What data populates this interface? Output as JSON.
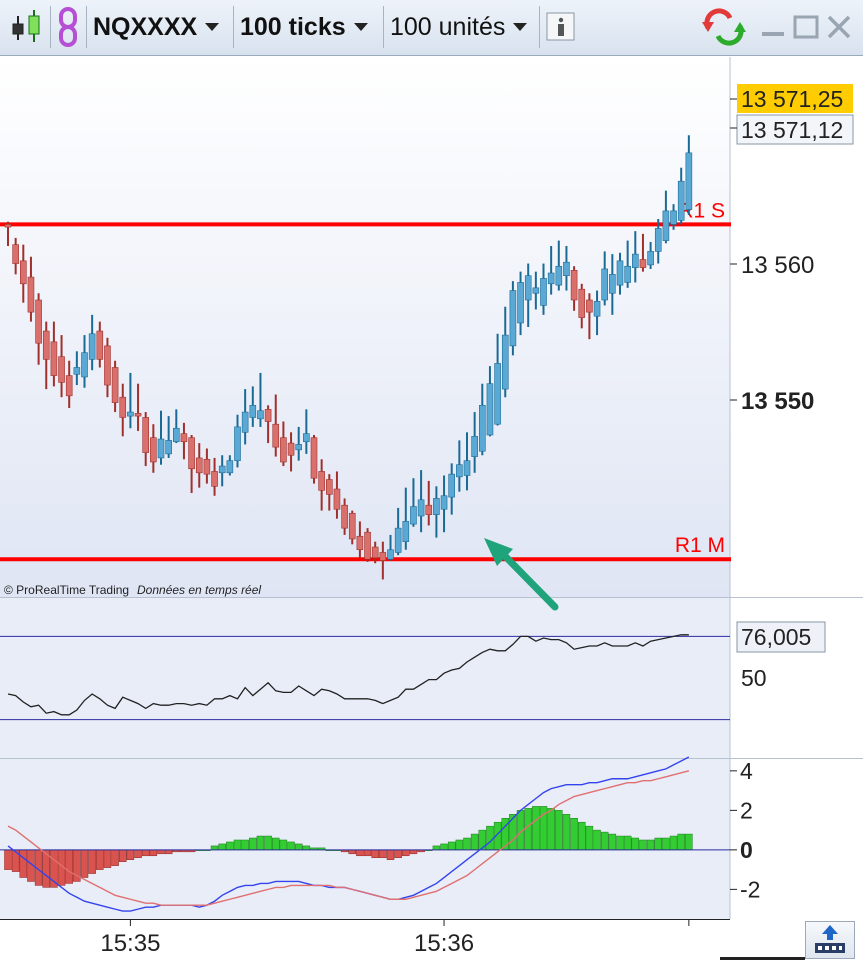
{
  "toolbar": {
    "symbol": "NQXXXX",
    "timeframe": "100 ticks",
    "units": "100 unités",
    "icons": [
      "candlestick-icon",
      "link-icon",
      "info-icon",
      "refresh-arrows-icon",
      "minimize-icon",
      "maximize-icon",
      "close-icon"
    ]
  },
  "copyright": "© ProRealTime Trading",
  "realtime_note": "Données en temps réel",
  "chart_data": [
    {
      "type": "candlestick",
      "price_labels": {
        "last": "13 571,25",
        "bid": "13 571,12",
        "tick_560": "13 560",
        "tick_550": "13 550"
      },
      "yticks": [
        13560,
        13550
      ],
      "ylim": [
        13538.4,
        13578.4
      ],
      "levels": [
        {
          "name": "R1 S",
          "value": 13566.0,
          "color": "#ff0000"
        },
        {
          "name": "R1 M",
          "value": 13541.2,
          "color": "#ff0000"
        }
      ],
      "up_color": "#5aa9d4",
      "down_color": "#d9706c",
      "candles": [
        [
          13566.0,
          13565.8,
          13564.4,
          13566.2
        ],
        [
          13564.5,
          13563.1,
          13562.3,
          13565.0
        ],
        [
          13563.3,
          13561.6,
          13560.2,
          13564.5
        ],
        [
          13562.1,
          13559.5,
          13558.8,
          13563.6
        ],
        [
          13560.4,
          13557.2,
          13555.6,
          13560.9
        ],
        [
          13558.1,
          13556.0,
          13553.8,
          13558.8
        ],
        [
          13557.3,
          13554.8,
          13554.0,
          13558.8
        ],
        [
          13556.2,
          13554.3,
          13553.2,
          13557.8
        ],
        [
          13554.8,
          13553.3,
          13552.4,
          13555.9
        ],
        [
          13554.9,
          13555.4,
          13554.1,
          13556.6
        ],
        [
          13554.7,
          13556.5,
          13553.9,
          13557.8
        ],
        [
          13556.0,
          13557.9,
          13555.2,
          13559.3
        ],
        [
          13558.1,
          13556.0,
          13555.4,
          13558.8
        ],
        [
          13557.0,
          13554.1,
          13553.2,
          13557.6
        ],
        [
          13555.4,
          13552.8,
          13552.1,
          13555.9
        ],
        [
          13553.2,
          13551.7,
          13550.3,
          13554.2
        ],
        [
          13551.8,
          13552.1,
          13550.9,
          13555.0
        ],
        [
          13552.0,
          13551.8,
          13550.7,
          13554.2
        ],
        [
          13551.7,
          13549.1,
          13548.1,
          13552.1
        ],
        [
          13550.2,
          13548.4,
          13547.6,
          13551.2
        ],
        [
          13548.7,
          13550.1,
          13548.2,
          13552.2
        ],
        [
          13549.0,
          13550.0,
          13548.7,
          13551.8
        ],
        [
          13549.9,
          13550.9,
          13549.8,
          13552.3
        ],
        [
          13550.5,
          13549.9,
          13548.6,
          13551.3
        ],
        [
          13550.2,
          13547.9,
          13546.1,
          13550.4
        ],
        [
          13548.7,
          13547.6,
          13546.5,
          13549.8
        ],
        [
          13548.6,
          13547.5,
          13546.8,
          13549.4
        ],
        [
          13547.7,
          13546.6,
          13545.9,
          13548.7
        ],
        [
          13547.6,
          13548.1,
          13546.6,
          13548.9
        ],
        [
          13547.6,
          13548.5,
          13547.4,
          13548.9
        ],
        [
          13548.5,
          13551.0,
          13548.0,
          13551.9
        ],
        [
          13550.6,
          13552.1,
          13549.7,
          13553.8
        ],
        [
          13551.7,
          13552.6,
          13551.0,
          13554.0
        ],
        [
          13551.6,
          13552.2,
          13551.0,
          13555.0
        ],
        [
          13552.3,
          13551.4,
          13549.8,
          13552.6
        ],
        [
          13551.2,
          13549.5,
          13548.8,
          13553.4
        ],
        [
          13550.2,
          13548.4,
          13548.1,
          13551.4
        ],
        [
          13549.8,
          13548.9,
          13547.7,
          13550.6
        ],
        [
          13549.3,
          13549.7,
          13548.5,
          13551.0
        ],
        [
          13549.9,
          13550.5,
          13549.0,
          13552.3
        ],
        [
          13550.2,
          13547.2,
          13546.8,
          13550.4
        ],
        [
          13547.7,
          13546.3,
          13544.8,
          13548.6
        ],
        [
          13547.1,
          13546.0,
          13544.8,
          13547.5
        ],
        [
          13546.4,
          13544.9,
          13544.2,
          13547.7
        ],
        [
          13545.2,
          13543.5,
          13543.0,
          13545.7
        ],
        [
          13544.6,
          13542.7,
          13542.3,
          13544.8
        ],
        [
          13542.9,
          13541.9,
          13541.3,
          13544.0
        ],
        [
          13543.2,
          13541.2,
          13541.0,
          13543.5
        ],
        [
          13542.1,
          13541.3,
          13540.9,
          13542.5
        ],
        [
          13541.7,
          13541.1,
          13539.7,
          13542.5
        ],
        [
          13541.2,
          13541.9,
          13541.1,
          13543.0
        ],
        [
          13541.7,
          13543.5,
          13541.5,
          13545.0
        ],
        [
          13542.5,
          13544.0,
          13541.9,
          13546.5
        ],
        [
          13543.8,
          13545.1,
          13543.6,
          13547.2
        ],
        [
          13544.4,
          13545.6,
          13543.2,
          13547.8
        ],
        [
          13545.2,
          13544.5,
          13543.7,
          13547.0
        ],
        [
          13544.5,
          13545.7,
          13542.8,
          13546.6
        ],
        [
          13544.9,
          13545.9,
          13543.2,
          13547.4
        ],
        [
          13545.8,
          13547.5,
          13544.5,
          13548.3
        ],
        [
          13547.3,
          13548.2,
          13546.2,
          13550.0
        ],
        [
          13547.4,
          13548.5,
          13546.3,
          13550.6
        ],
        [
          13548.8,
          13550.3,
          13547.6,
          13552.1
        ],
        [
          13549.2,
          13552.6,
          13548.9,
          13554.2
        ],
        [
          13550.4,
          13554.2,
          13550.3,
          13555.5
        ],
        [
          13551.2,
          13555.7,
          13551.1,
          13557.9
        ],
        [
          13553.8,
          13557.8,
          13553.2,
          13559.9
        ],
        [
          13557.0,
          13561.1,
          13556.3,
          13561.8
        ],
        [
          13558.7,
          13561.7,
          13557.8,
          13562.5
        ],
        [
          13560.4,
          13562.2,
          13558.4,
          13563.1
        ],
        [
          13560.9,
          13561.3,
          13559.7,
          13562.5
        ],
        [
          13560.0,
          13562.0,
          13559.3,
          13563.1
        ],
        [
          13561.6,
          13562.4,
          13560.8,
          13564.4
        ],
        [
          13561.5,
          13562.9,
          13561.1,
          13564.8
        ],
        [
          13562.2,
          13563.2,
          13561.1,
          13564.4
        ],
        [
          13562.6,
          13560.4,
          13559.6,
          13562.9
        ],
        [
          13561.2,
          13559.1,
          13558.3,
          13561.6
        ],
        [
          13560.4,
          13559.5,
          13557.5,
          13560.9
        ],
        [
          13559.2,
          13560.3,
          13557.8,
          13561.1
        ],
        [
          13560.4,
          13562.7,
          13560.0,
          13564.0
        ],
        [
          13560.9,
          13562.3,
          13559.3,
          13563.8
        ],
        [
          13561.5,
          13563.3,
          13560.8,
          13563.9
        ],
        [
          13561.7,
          13562.9,
          13561.3,
          13564.8
        ],
        [
          13562.8,
          13563.8,
          13561.7,
          13565.5
        ],
        [
          13563.4,
          13562.8,
          13562.5,
          13565.3
        ],
        [
          13563.0,
          13564.0,
          13562.7,
          13564.7
        ],
        [
          13564.0,
          13565.7,
          13563.1,
          13566.4
        ],
        [
          13564.8,
          13567.0,
          13564.6,
          13568.5
        ],
        [
          13566.0,
          13567.0,
          13565.6,
          13567.5
        ],
        [
          13566.3,
          13569.2,
          13566.0,
          13570.2
        ],
        [
          13567.1,
          13571.3,
          13566.7,
          13572.6
        ]
      ],
      "candle_format": [
        "open",
        "close",
        "low",
        "high"
      ]
    },
    {
      "type": "line",
      "name": "oscillator",
      "value_label": "76,005",
      "yticks_labels": [
        "50"
      ],
      "upper_level_value": 76,
      "lower_level_value": 24,
      "ylim": [
        0,
        100
      ],
      "color": "#222222",
      "values": [
        40,
        39,
        35,
        32,
        33,
        28,
        29,
        27,
        27,
        30,
        36,
        40,
        37,
        33,
        31,
        38,
        36,
        34,
        31,
        34,
        33,
        33,
        34,
        34,
        33,
        34,
        33,
        37,
        37,
        39,
        37,
        44,
        39,
        43,
        47,
        42,
        41,
        41,
        45,
        42,
        39,
        43,
        42,
        40,
        37,
        37,
        37,
        37,
        36,
        34,
        36,
        38,
        43,
        43,
        46,
        49,
        49,
        53,
        55,
        56,
        60,
        63,
        66,
        68,
        67,
        67,
        71,
        76,
        76,
        73,
        75,
        74,
        74,
        72,
        68,
        69,
        70,
        70,
        72,
        70,
        70,
        70,
        72,
        70,
        73,
        74,
        75,
        76,
        77,
        77
      ]
    },
    {
      "type": "bar+line",
      "name": "macd",
      "yticks": [
        4,
        2,
        0,
        -2
      ],
      "ylim": [
        -3.5,
        4.6
      ],
      "histogram_pos_color": "#33cc33",
      "histogram_neg_color": "#d9534f",
      "histogram": [
        -1.0,
        -1.1,
        -1.4,
        -1.6,
        -1.8,
        -1.9,
        -1.9,
        -1.8,
        -1.7,
        -1.6,
        -1.4,
        -1.2,
        -1.0,
        -0.9,
        -0.8,
        -0.6,
        -0.5,
        -0.4,
        -0.3,
        -0.3,
        -0.2,
        -0.2,
        -0.1,
        -0.1,
        -0.1,
        0.0,
        0.0,
        0.2,
        0.3,
        0.4,
        0.5,
        0.5,
        0.6,
        0.7,
        0.7,
        0.6,
        0.5,
        0.4,
        0.3,
        0.2,
        0.1,
        0.1,
        0.0,
        0.0,
        -0.1,
        -0.2,
        -0.3,
        -0.3,
        -0.4,
        -0.4,
        -0.5,
        -0.4,
        -0.3,
        -0.2,
        -0.1,
        0.0,
        0.2,
        0.3,
        0.4,
        0.5,
        0.6,
        0.8,
        1.0,
        1.2,
        1.4,
        1.6,
        1.8,
        2.0,
        2.1,
        2.2,
        2.2,
        2.1,
        2.0,
        1.8,
        1.6,
        1.4,
        1.2,
        1.0,
        0.9,
        0.8,
        0.7,
        0.7,
        0.6,
        0.5,
        0.5,
        0.6,
        0.6,
        0.7,
        0.8,
        0.8
      ],
      "macd_line_color": "#3344ee",
      "signal_line_color": "#e07070",
      "macd_line": [
        0.2,
        -0.1,
        -0.4,
        -0.7,
        -1.0,
        -1.3,
        -1.6,
        -1.9,
        -2.2,
        -2.4,
        -2.6,
        -2.7,
        -2.8,
        -2.9,
        -3.0,
        -3.1,
        -3.1,
        -3.0,
        -2.9,
        -2.9,
        -2.8,
        -2.8,
        -2.8,
        -2.8,
        -2.8,
        -2.9,
        -2.8,
        -2.6,
        -2.3,
        -2.1,
        -1.9,
        -1.8,
        -1.8,
        -1.7,
        -1.7,
        -1.6,
        -1.6,
        -1.6,
        -1.6,
        -1.7,
        -1.8,
        -1.8,
        -1.9,
        -1.9,
        -1.9,
        -2.0,
        -2.1,
        -2.2,
        -2.3,
        -2.4,
        -2.5,
        -2.5,
        -2.4,
        -2.3,
        -2.1,
        -1.9,
        -1.7,
        -1.4,
        -1.1,
        -0.8,
        -0.5,
        -0.2,
        0.1,
        0.4,
        0.8,
        1.2,
        1.6,
        2.0,
        2.3,
        2.6,
        2.9,
        3.1,
        3.2,
        3.3,
        3.3,
        3.3,
        3.4,
        3.4,
        3.5,
        3.6,
        3.6,
        3.6,
        3.7,
        3.8,
        3.9,
        4.0,
        4.1,
        4.3,
        4.5,
        4.7
      ],
      "signal_line": [
        1.2,
        1.0,
        0.7,
        0.4,
        0.1,
        -0.2,
        -0.5,
        -0.8,
        -1.1,
        -1.3,
        -1.5,
        -1.7,
        -1.9,
        -2.1,
        -2.3,
        -2.4,
        -2.5,
        -2.6,
        -2.7,
        -2.7,
        -2.8,
        -2.8,
        -2.8,
        -2.8,
        -2.8,
        -2.8,
        -2.8,
        -2.7,
        -2.6,
        -2.5,
        -2.4,
        -2.3,
        -2.2,
        -2.1,
        -2.0,
        -1.9,
        -1.9,
        -1.8,
        -1.8,
        -1.8,
        -1.8,
        -1.8,
        -1.8,
        -1.9,
        -1.9,
        -2.0,
        -2.1,
        -2.2,
        -2.3,
        -2.4,
        -2.5,
        -2.5,
        -2.5,
        -2.4,
        -2.3,
        -2.2,
        -2.1,
        -1.9,
        -1.7,
        -1.5,
        -1.3,
        -1.0,
        -0.7,
        -0.4,
        -0.1,
        0.2,
        0.5,
        0.9,
        1.2,
        1.5,
        1.8,
        2.0,
        2.3,
        2.5,
        2.7,
        2.8,
        2.9,
        3.0,
        3.1,
        3.2,
        3.3,
        3.4,
        3.4,
        3.5,
        3.5,
        3.6,
        3.7,
        3.8,
        3.9,
        4.0
      ]
    }
  ],
  "time_axis": {
    "labels": [
      "15:35",
      "15:36"
    ],
    "label_bar_index": [
      16,
      57
    ]
  }
}
